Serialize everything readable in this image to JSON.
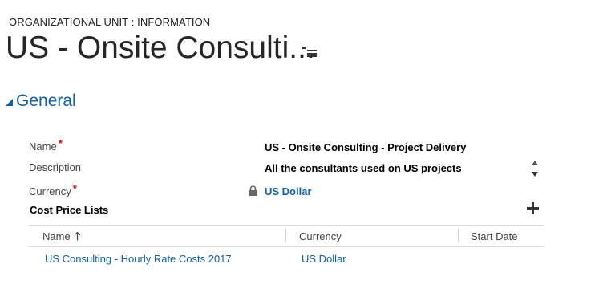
{
  "header": {
    "entity_label": "ORGANIZATIONAL UNIT : INFORMATION",
    "record_title": "US - Onsite Consulti..."
  },
  "section": {
    "title": "General"
  },
  "fields": {
    "name": {
      "label": "Name",
      "required_mark": "*",
      "value": "US - Onsite Consulting - Project Delivery"
    },
    "description": {
      "label": "Description",
      "value": "All the consultants used on US projects"
    },
    "currency": {
      "label": "Currency",
      "required_mark": "*",
      "value": "US Dollar"
    }
  },
  "subgrid": {
    "title": "Cost Price Lists",
    "columns": [
      "Name",
      "Currency",
      "Start Date"
    ],
    "rows": [
      {
        "name": "US Consulting - Hourly Rate Costs 2017",
        "currency": "US Dollar",
        "start_date": ""
      }
    ]
  },
  "icons": {
    "menu": "hamburger-menu-icon",
    "collapse": "collapse-triangle-icon",
    "lock": "lock-icon",
    "add": "plus-icon",
    "sort": "arrow-up-icon",
    "spinner_up": "caret-up-icon",
    "spinner_down": "caret-down-icon"
  },
  "colors": {
    "accent": "#1160a8",
    "required": "#e00000",
    "text": "#000000",
    "label": "#444444"
  }
}
